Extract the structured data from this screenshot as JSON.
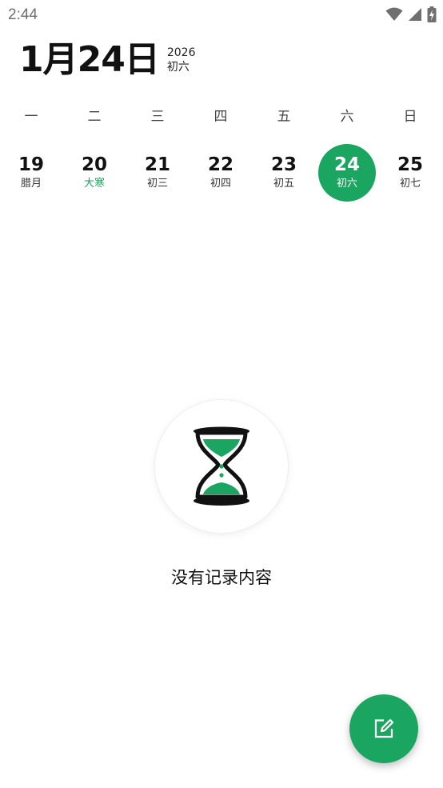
{
  "status_bar": {
    "time": "2:44",
    "icons": [
      "wifi-icon",
      "cellular-signal-icon",
      "battery-charging-icon"
    ]
  },
  "header": {
    "date": "1月24日",
    "year": "2026",
    "lunar": "初六"
  },
  "weekdays": [
    "一",
    "二",
    "三",
    "四",
    "五",
    "六",
    "日"
  ],
  "days": [
    {
      "num": "19",
      "lunar": "腊月"
    },
    {
      "num": "20",
      "lunar": "大寒"
    },
    {
      "num": "21",
      "lunar": "初三"
    },
    {
      "num": "22",
      "lunar": "初四"
    },
    {
      "num": "23",
      "lunar": "初五"
    },
    {
      "num": "24",
      "lunar": "初六"
    },
    {
      "num": "25",
      "lunar": "初七"
    }
  ],
  "selected_day": "24",
  "solar_term_day": "20",
  "empty_state": {
    "icon": "hourglass-icon",
    "text": "没有记录内容"
  },
  "fab": {
    "icon": "edit-icon"
  },
  "colors": {
    "accent": "#1aa560",
    "text": "#111111",
    "muted": "#6f6f6f"
  }
}
